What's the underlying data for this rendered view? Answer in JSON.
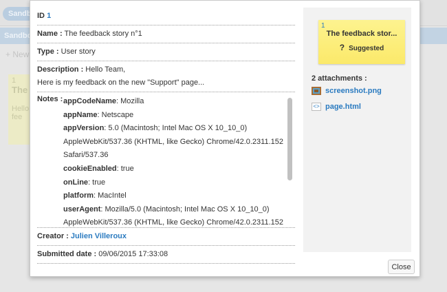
{
  "background": {
    "sandbox_pill": "Sandbox",
    "sandbox_bar": "Sandbox",
    "new_button": "+ New",
    "card": {
      "id": "1",
      "title": "The",
      "text1": "Hello",
      "text2": "fee"
    }
  },
  "details": {
    "id_label": "ID",
    "id_value": "1",
    "name_label": "Name :",
    "name_value": "The feedback story n°1",
    "type_label": "Type :",
    "type_value": "User story",
    "description_label": "Description :",
    "description_line1": "Hello Team,",
    "description_line2": "Here is my feedback on the new \"Support\" page...",
    "notes_label": "Notes :",
    "notes": [
      {
        "key": "appCodeName",
        "value": ": Mozilla"
      },
      {
        "key": "appName",
        "value": ": Netscape"
      },
      {
        "key": "appVersion",
        "value": ": 5.0 (Macintosh; Intel Mac OS X 10_10_0)"
      },
      {
        "key": "",
        "value": "AppleWebKit/537.36 (KHTML, like Gecko) Chrome/42.0.2311.152"
      },
      {
        "key": "",
        "value": "Safari/537.36"
      },
      {
        "key": "cookieEnabled",
        "value": ": true"
      },
      {
        "key": "onLine",
        "value": ": true"
      },
      {
        "key": "platform",
        "value": ": MacIntel"
      },
      {
        "key": "userAgent",
        "value": ": Mozilla/5.0 (Macintosh; Intel Mac OS X 10_10_0)"
      },
      {
        "key": "",
        "value": "AppleWebKit/537.36 (KHTML, like Gecko) Chrome/42.0.2311.152"
      }
    ],
    "creator_label": "Creator :",
    "creator_value": "Julien Villeroux",
    "submitted_label": "Submitted date :",
    "submitted_value": "09/06/2015 17:33:08"
  },
  "sidebar": {
    "card": {
      "id": "1",
      "title": "The feedback stor...",
      "status_icon": "?",
      "status": "Suggested"
    },
    "attachments_label": "2 attachments :",
    "attachments": [
      {
        "name": "screenshot.png",
        "icon": "image-file-icon"
      },
      {
        "name": "page.html",
        "icon": "html-file-icon"
      }
    ]
  },
  "close_label": "Close",
  "colors": {
    "link": "#2b7bc0",
    "sticky": "#fbe96a"
  }
}
